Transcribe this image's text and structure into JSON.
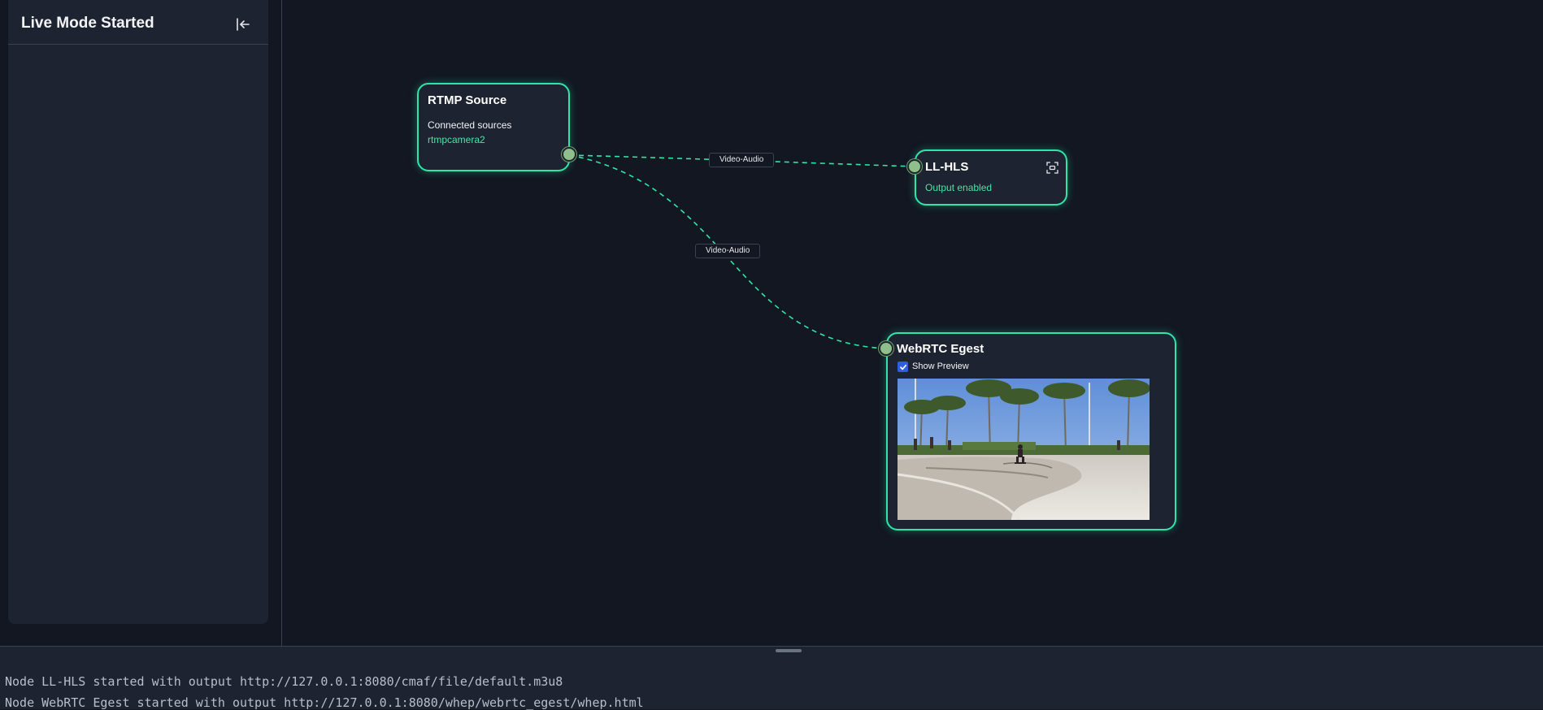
{
  "sidebar": {
    "title": "Live Mode Started",
    "collapse_icon": "collapse-left-icon"
  },
  "graph": {
    "edges": [
      {
        "label": "Video-Audio",
        "from": "RTMP Source",
        "to": "LL-HLS"
      },
      {
        "label": "Video-Audio",
        "from": "RTMP Source",
        "to": "WebRTC Egest"
      }
    ],
    "nodes": {
      "rtmp": {
        "title": "RTMP Source",
        "subtitle": "Connected sources",
        "source": "rtmpcamera2"
      },
      "llhls": {
        "title": "LL-HLS",
        "status": "Output enabled",
        "action_icon": "focus-icon"
      },
      "webrtc": {
        "title": "WebRTC Egest",
        "show_preview_label": "Show Preview",
        "show_preview_checked": true,
        "preview_icon": "video-preview-skatepark"
      }
    }
  },
  "log": {
    "lines": [
      "Node LL-HLS started with output http://127.0.0.1:8080/cmaf/file/default.m3u8",
      "Node WebRTC Egest started with output http://127.0.0.1:8080/whep/webrtc_egest/whep.html"
    ]
  },
  "colors": {
    "accent": "#2ee6a8",
    "accent_text": "#4fe3a4",
    "background": "#121722",
    "panel": "#1d2330",
    "handle": "#8fbf8a",
    "checkbox": "#2f5fe0"
  }
}
